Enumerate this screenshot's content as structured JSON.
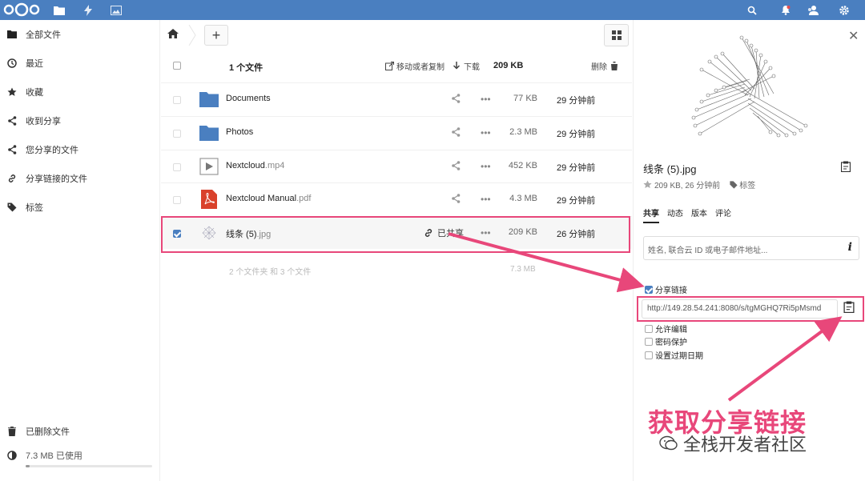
{
  "colors": {
    "topbar": "#4a7fc0",
    "accent": "#e8477a",
    "folder": "#4a7fc0"
  },
  "topbar": {
    "icons": [
      "nextcloud-logo",
      "files-icon",
      "activity-icon",
      "gallery-icon",
      "search-icon",
      "notifications-icon",
      "contacts-icon",
      "settings-icon"
    ]
  },
  "sidebar": {
    "items": [
      {
        "label": "全部文件",
        "icon": "folder-icon"
      },
      {
        "label": "最近",
        "icon": "clock-icon"
      },
      {
        "label": "收藏",
        "icon": "star-icon"
      },
      {
        "label": "收到分享",
        "icon": "share-icon"
      },
      {
        "label": "您分享的文件",
        "icon": "share-icon"
      },
      {
        "label": "分享链接的文件",
        "icon": "link-icon"
      },
      {
        "label": "标签",
        "icon": "tag-icon"
      }
    ],
    "deleted": "已删除文件",
    "quota": "7.3 MB 已使用",
    "quota_fraction": 0.03
  },
  "toolbar": {
    "add_label": "+"
  },
  "header": {
    "count": "1 个文件",
    "move_copy": "移动或者复制",
    "download": "下载",
    "size": "209 KB",
    "delete": "删除"
  },
  "files": [
    {
      "name": "Documents",
      "ext": "",
      "type": "folder",
      "size": "77 KB",
      "modified": "29 分钟前",
      "shared": ""
    },
    {
      "name": "Photos",
      "ext": "",
      "type": "folder",
      "size": "2.3 MB",
      "modified": "29 分钟前",
      "shared": ""
    },
    {
      "name": "Nextcloud",
      "ext": ".mp4",
      "type": "video",
      "size": "452 KB",
      "modified": "29 分钟前",
      "shared": ""
    },
    {
      "name": "Nextcloud Manual",
      "ext": ".pdf",
      "type": "pdf",
      "size": "4.3 MB",
      "modified": "29 分钟前",
      "shared": ""
    },
    {
      "name": "线条 (5)",
      "ext": ".jpg",
      "type": "image",
      "size": "209 KB",
      "modified": "26 分钟前",
      "shared": "已共享"
    }
  ],
  "summary": {
    "text": "2 个文件夹 和 3 个文件",
    "size": "7.3 MB"
  },
  "panel": {
    "title": "线条 (5).jpg",
    "meta": "209 KB, 26 分钟前",
    "tags": "标签",
    "tabs": [
      "共享",
      "动态",
      "版本",
      "评论"
    ],
    "share_placeholder": "姓名, 联合云 ID 或电子邮件地址...",
    "share_link_label": "分享链接",
    "link_url": "http://149.28.54.241:8080/s/tgMGHQ7Ri5pMsmd",
    "options": [
      "允许编辑",
      "密码保护",
      "设置过期日期"
    ]
  },
  "annotation": {
    "text": "获取分享链接"
  },
  "watermark": {
    "text": "全栈开发者社区"
  }
}
